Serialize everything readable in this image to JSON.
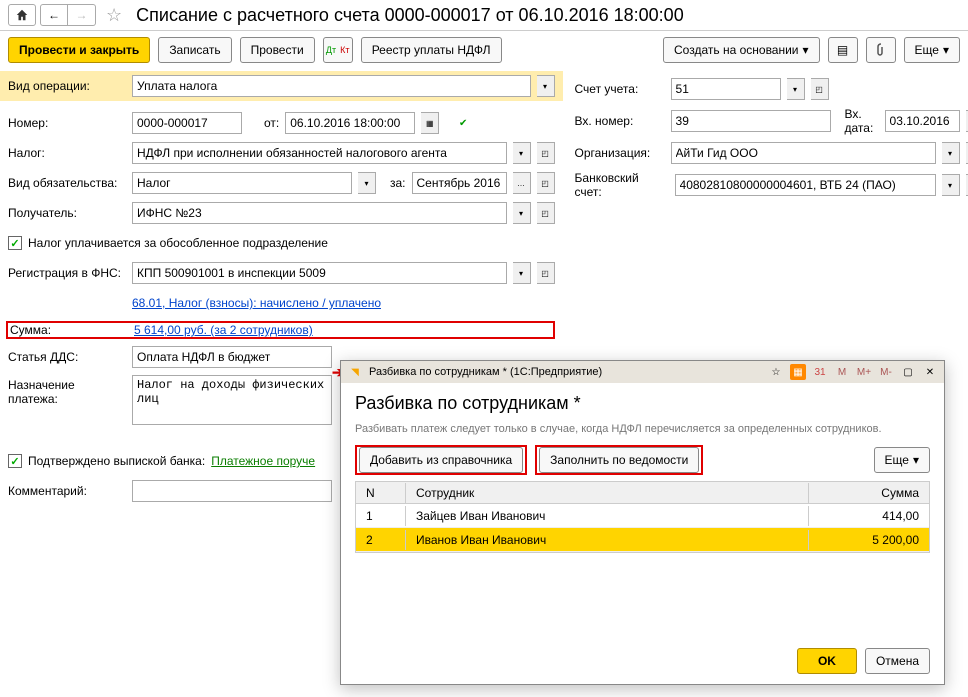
{
  "header": {
    "title": "Списание с расчетного счета 0000-000017 от 06.10.2016 18:00:00"
  },
  "toolbar": {
    "post_close": "Провести и закрыть",
    "save": "Записать",
    "post": "Провести",
    "ndfl_registry": "Реестр уплаты НДФЛ",
    "create_based": "Создать на основании",
    "more": "Еще"
  },
  "form": {
    "operation_type_lbl": "Вид операции:",
    "operation_type": "Уплата налога",
    "number_lbl": "Номер:",
    "number": "0000-000017",
    "date_lbl": "от:",
    "date": "06.10.2016 18:00:00",
    "tax_lbl": "Налог:",
    "tax": "НДФЛ при исполнении обязанностей налогового агента",
    "obligation_lbl": "Вид обязательства:",
    "obligation": "Налог",
    "period_lbl": "за:",
    "period": "Сентябрь 2016",
    "recipient_lbl": "Получатель:",
    "recipient": "ИФНС №23",
    "separate_div": "Налог уплачивается за обособленное подразделение",
    "fns_reg_lbl": "Регистрация в ФНС:",
    "fns_reg": "КПП 500901001 в инспекции 5009",
    "account_link": "68.01, Налог (взносы): начислено / уплачено",
    "sum_lbl": "Сумма:",
    "sum_link": "5 614,00 руб. (за 2 сотрудников)",
    "dds_lbl": "Статья ДДС:",
    "dds": "Оплата НДФЛ в бюджет",
    "purpose_lbl": "Назначение платежа:",
    "purpose": "Налог на доходы физических лиц",
    "bank_confirmed": "Подтверждено выпиской банка:",
    "payment_order": "Платежное поруче",
    "comment_lbl": "Комментарий:",
    "account_lbl": "Счет учета:",
    "account": "51",
    "in_number_lbl": "Вх. номер:",
    "in_number": "39",
    "in_date_lbl": "Вх. дата:",
    "in_date": "03.10.2016",
    "org_lbl": "Организация:",
    "org": "АйТи Гид ООО",
    "bank_acc_lbl": "Банковский счет:",
    "bank_acc": "40802810800000004601, ВТБ 24 (ПАО)"
  },
  "popup": {
    "window_title": "Разбивка по сотрудникам * (1С:Предприятие)",
    "title": "Разбивка по сотрудникам *",
    "hint": "Разбивать платеж следует только в случае, когда НДФЛ перечисляется за определенных сотрудников.",
    "add_from_catalog": "Добавить из справочника",
    "fill_by_register": "Заполнить по ведомости",
    "more": "Еще",
    "col_n": "N",
    "col_emp": "Сотрудник",
    "col_sum": "Сумма",
    "rows": [
      {
        "n": "1",
        "name": "Зайцев Иван Иванович",
        "sum": "414,00"
      },
      {
        "n": "2",
        "name": "Иванов Иван Иванович",
        "sum": "5 200,00"
      }
    ],
    "ok": "OK",
    "cancel": "Отмена",
    "m": "М",
    "mplus": "М+",
    "mminus": "М-"
  }
}
